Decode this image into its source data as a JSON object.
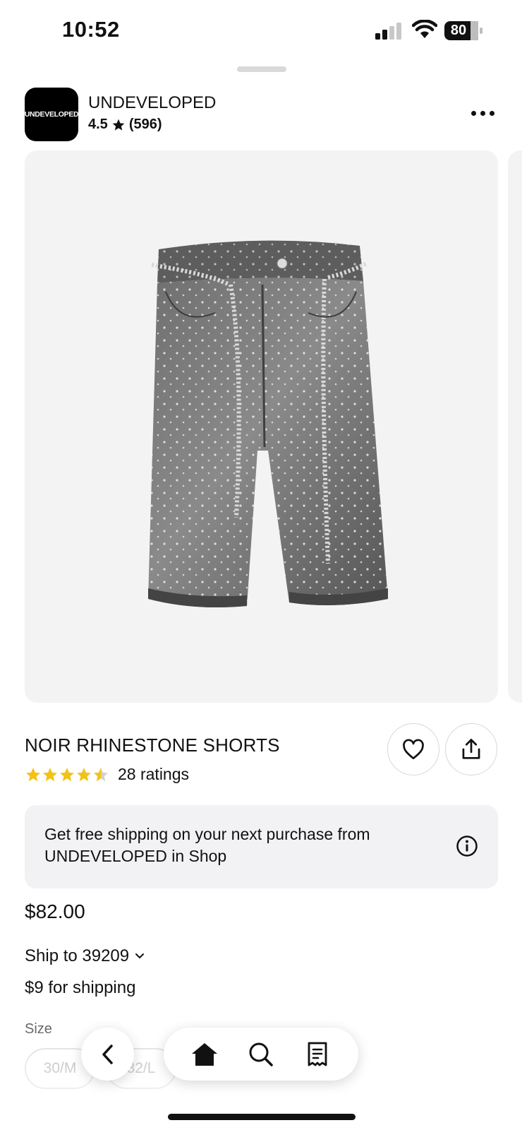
{
  "status_bar": {
    "time": "10:52",
    "battery": "80"
  },
  "shop": {
    "logo_text": "UNDEVELOPED",
    "name": "UNDEVELOPED",
    "rating": "4.5",
    "review_count": "(596)"
  },
  "product": {
    "image_icon": "denim-shorts-image",
    "title": "NOIR RHINESTONE SHORTS",
    "star_rating": 4.5,
    "ratings_label": "28 ratings",
    "price": "$82.00"
  },
  "shipping_banner": {
    "text": "Get free shipping on your next purchase from UNDEVELOPED in Shop"
  },
  "shipping": {
    "ship_to": "Ship to 39209",
    "cost": "$9 for shipping"
  },
  "size": {
    "label": "Size",
    "options": [
      "30/M",
      "32/L"
    ]
  },
  "colors": {
    "star": "#f2c316",
    "banner_bg": "#f2f2f4",
    "image_bg": "#f3f3f3"
  }
}
